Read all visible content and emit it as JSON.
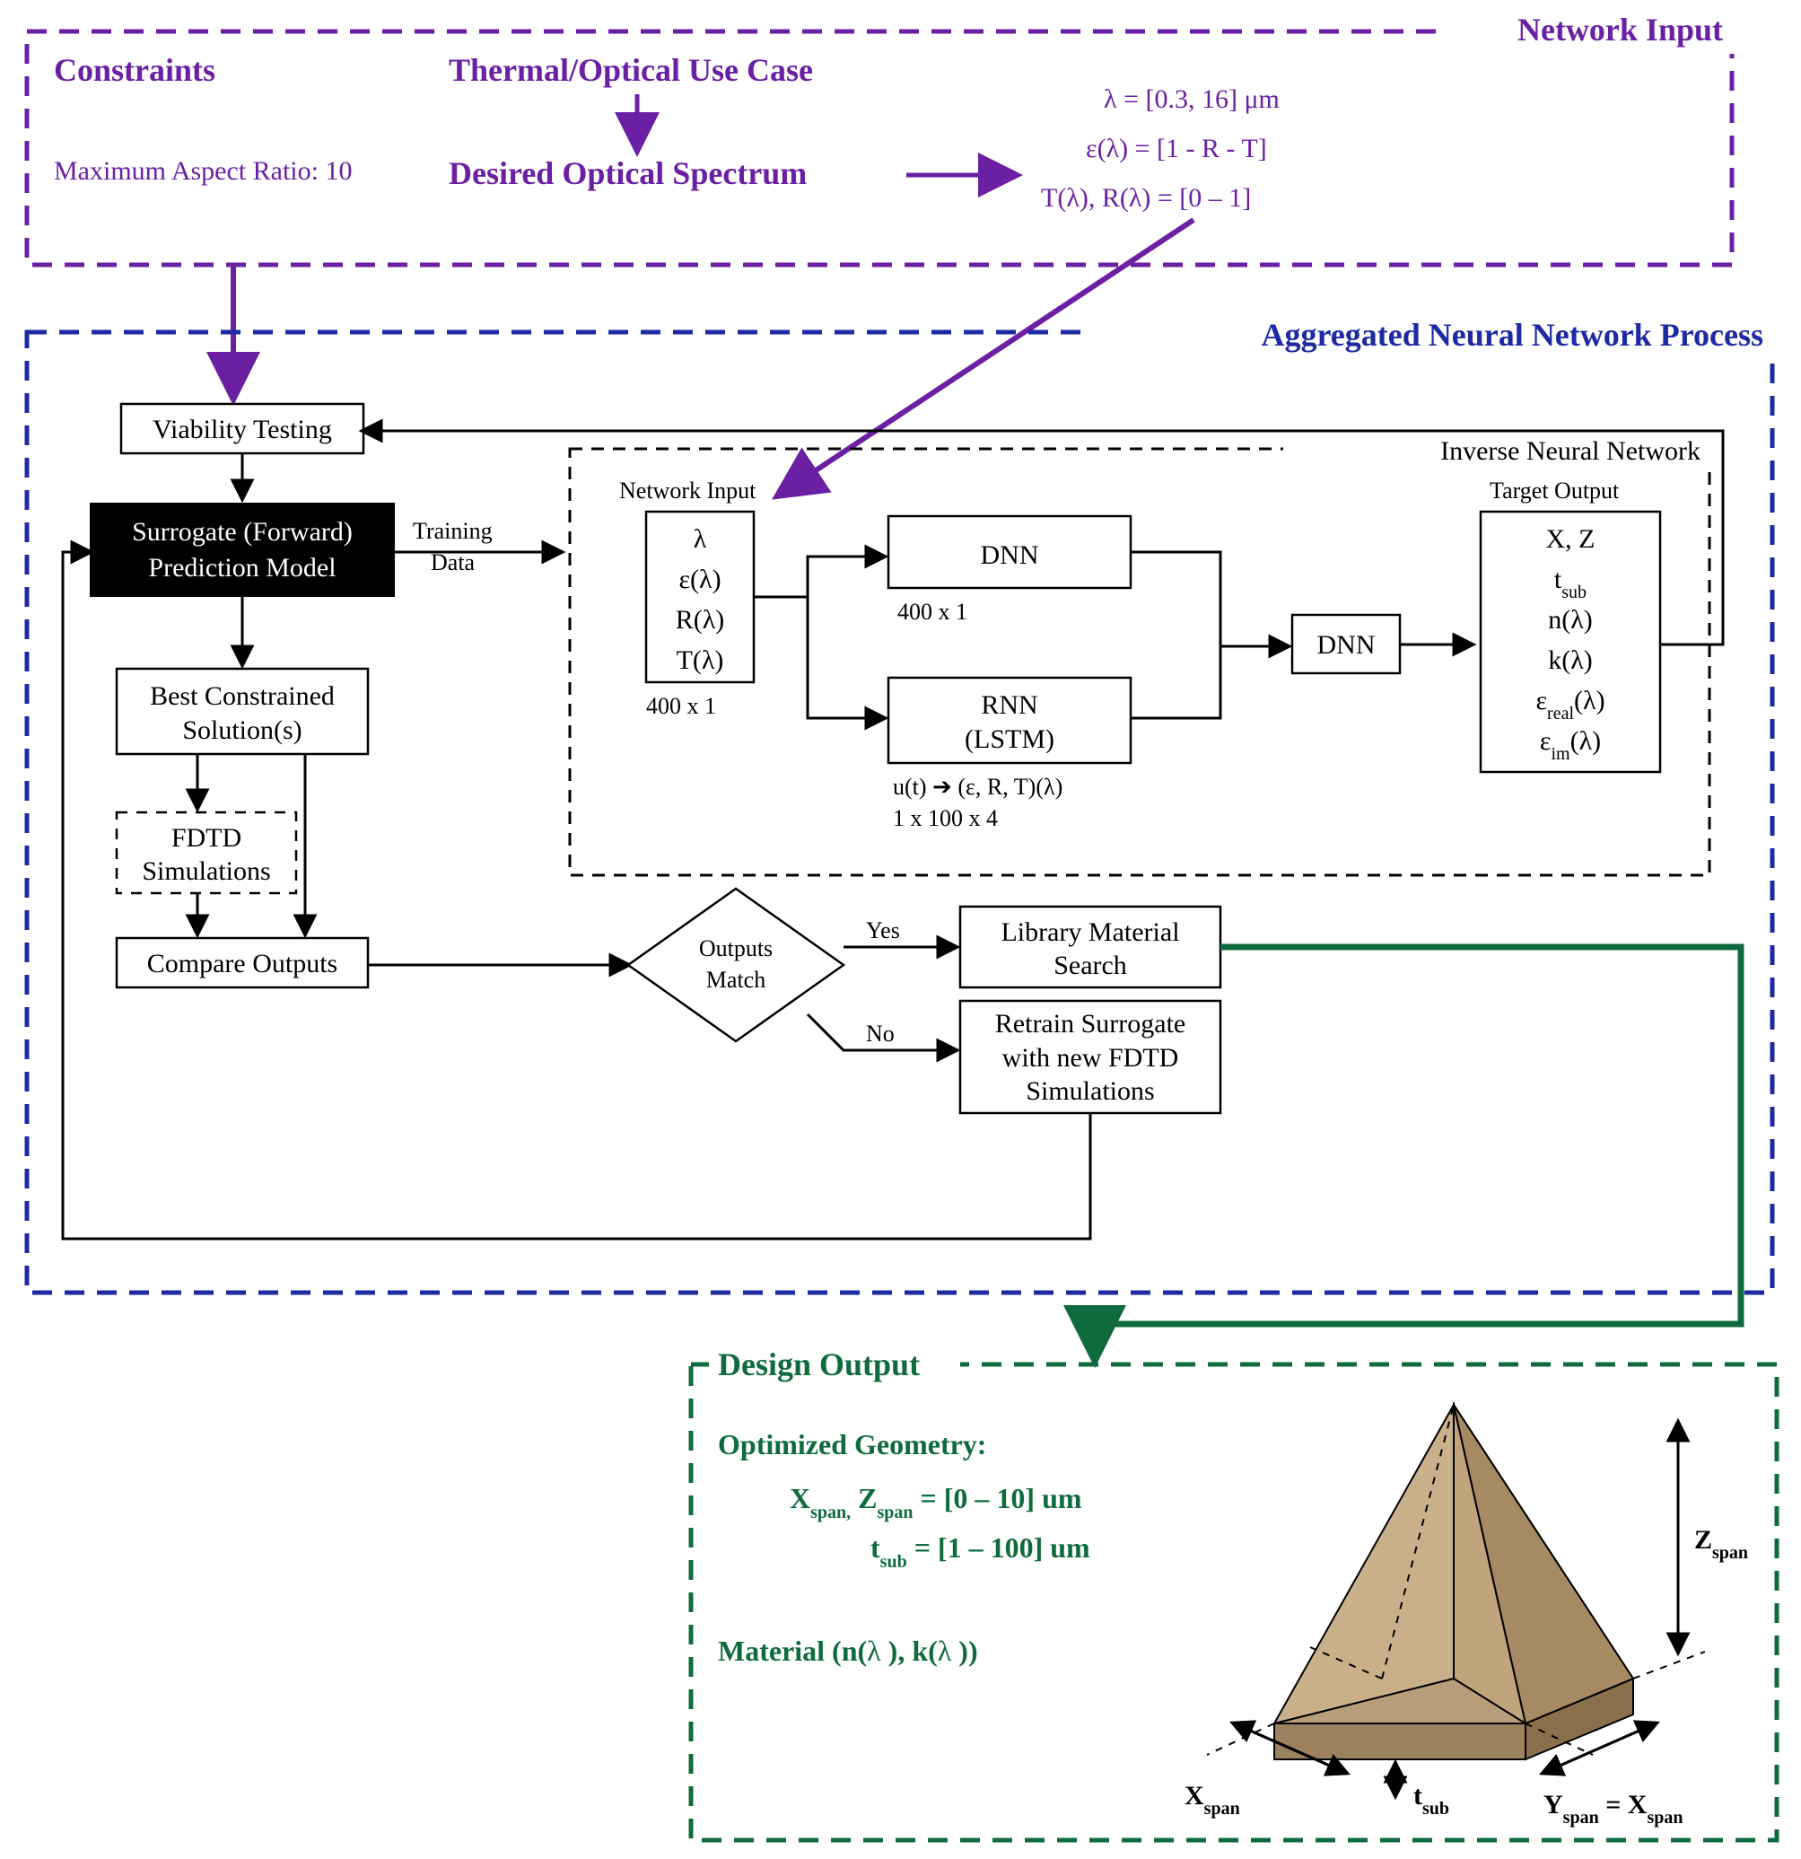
{
  "sections": {
    "network_input_title": "Network Input",
    "aggregated_title": "Aggregated Neural Network Process",
    "design_output_title": "Design Output",
    "inverse_title": "Inverse Neural Network"
  },
  "network_input": {
    "constraints_label": "Constraints",
    "constraints_value": "Maximum Aspect Ratio: 10",
    "usecase_line1": "Thermal/Optical Use Case",
    "usecase_line2": "Desired Optical Spectrum",
    "spec_line1": "λ = [0.3, 16] μm",
    "spec_line2": "ε(λ) = [1 - R - T]",
    "spec_line3": "T(λ), R(λ) = [0 – 1]"
  },
  "process": {
    "viability": "Viability Testing",
    "surrogate_line1": "Surrogate (Forward)",
    "surrogate_line2": "Prediction Model",
    "best_line1": "Best Constrained",
    "best_line2": "Solution(s)",
    "fdtd_line1": "FDTD",
    "fdtd_line2": "Simulations",
    "compare": "Compare Outputs",
    "training_data_line1": "Training",
    "training_data_line2": "Data",
    "decision_line1": "Outputs",
    "decision_line2": "Match",
    "yes": "Yes",
    "no": "No",
    "library_line1": "Library Material",
    "library_line2": "Search",
    "retrain_line1": "Retrain Surrogate",
    "retrain_line2": "with new FDTD",
    "retrain_line3": "Simulations"
  },
  "inverse": {
    "input_title": "Network Input",
    "input_lines": [
      "λ",
      "ε(λ)",
      "R(λ)",
      "T(λ)"
    ],
    "input_dim": "400 x 1",
    "dnn": "DNN",
    "dnn_dim": "400 x 1",
    "rnn_line1": "RNN",
    "rnn_line2": "(LSTM)",
    "rnn_note1": "u(t) ➔ (ε, R, T)(λ)",
    "rnn_note2": "1 x 100 x 4",
    "dnn2": "DNN",
    "target_title": "Target Output",
    "target_lines": [
      "X, Z",
      "t",
      "n(λ)",
      "k(λ)",
      "ε",
      "ε"
    ],
    "target_sub2": "sub",
    "target_sub5": "real",
    "target_sub6": "im",
    "target_tail5": "(λ)",
    "target_tail6": "(λ)"
  },
  "design_output": {
    "opt_geom_title": "Optimized Geometry:",
    "geom_line1_a": "X",
    "geom_line1_b": "Z",
    "geom_line1_val": " = [0 – 10] um",
    "geom_line2_a": "t",
    "geom_line2_val": " = [1 – 100] um",
    "material_label_a": "Material (n(",
    "material_label_b": "), k(",
    "material_label_c": "))",
    "lambda": "λ",
    "span": "span,",
    "span2": "span",
    "sub": "sub",
    "zspan": "Z",
    "yspan": "Y",
    "eqx": " = X",
    "xspan": "X",
    "tsub": "t"
  }
}
